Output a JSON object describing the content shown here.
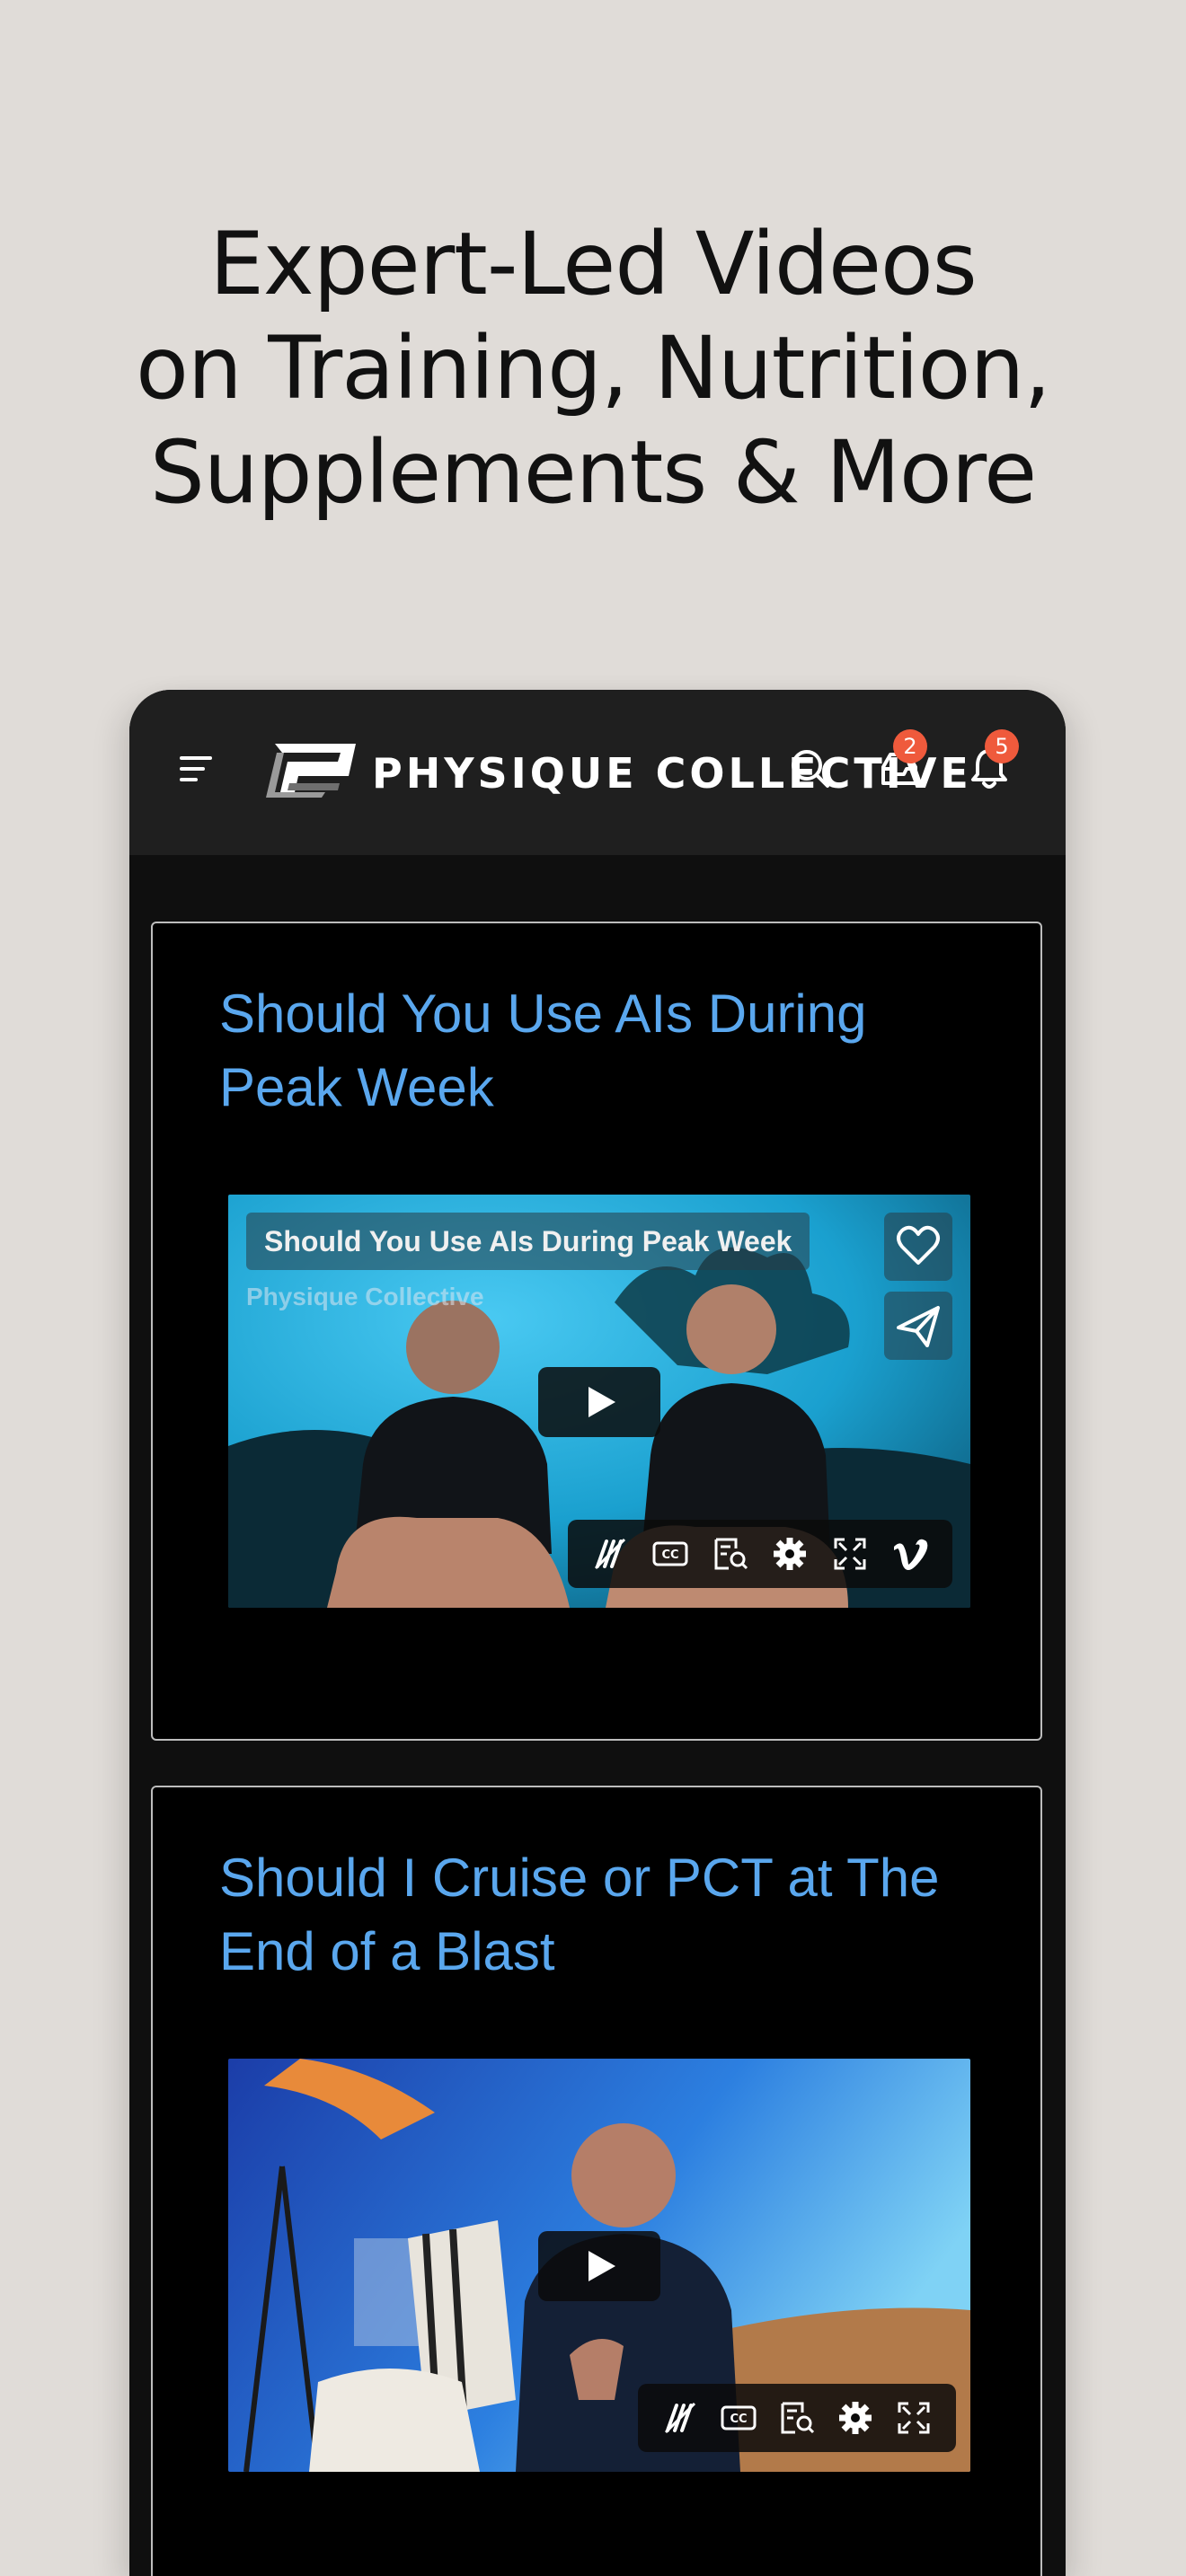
{
  "headline": {
    "line1": "Expert-Led Videos",
    "line2": "on Training, Nutrition,",
    "line3": "Supplements & More"
  },
  "app": {
    "brand": "PHYSIQUE COLLECTIVE",
    "inbox_badge": "2",
    "notifications_badge": "5"
  },
  "videos": [
    {
      "title": "Should You Use AIs During Peak Week",
      "overlay_title": "Should You Use AIs During Peak Week",
      "overlay_author": "Physique Collective"
    },
    {
      "title": "Should I Cruise or PCT at The End of a Blast"
    }
  ],
  "colors": {
    "page_bg": "#e0dcd8",
    "title_link": "#5aa7ee",
    "badge": "#ef5a3c",
    "topbar": "#1f1f1f"
  }
}
